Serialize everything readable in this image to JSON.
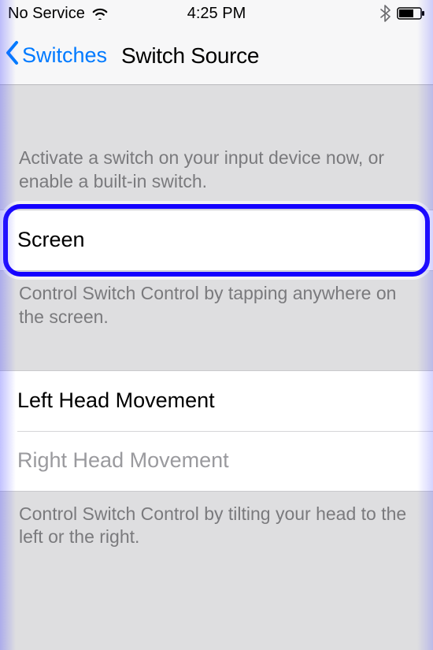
{
  "status": {
    "carrier": "No Service",
    "time": "4:25 PM"
  },
  "nav": {
    "back_label": "Switches",
    "title": "Switch Source"
  },
  "section1": {
    "header": "Activate a switch on your input device now, or enable a built-in switch.",
    "cell_screen": "Screen",
    "footer": "Control Switch Control by tapping anywhere on the screen."
  },
  "section2": {
    "cell_left": "Left Head Movement",
    "cell_right": "Right Head Movement",
    "footer": "Control Switch Control by tilting your head to the left or the right."
  }
}
